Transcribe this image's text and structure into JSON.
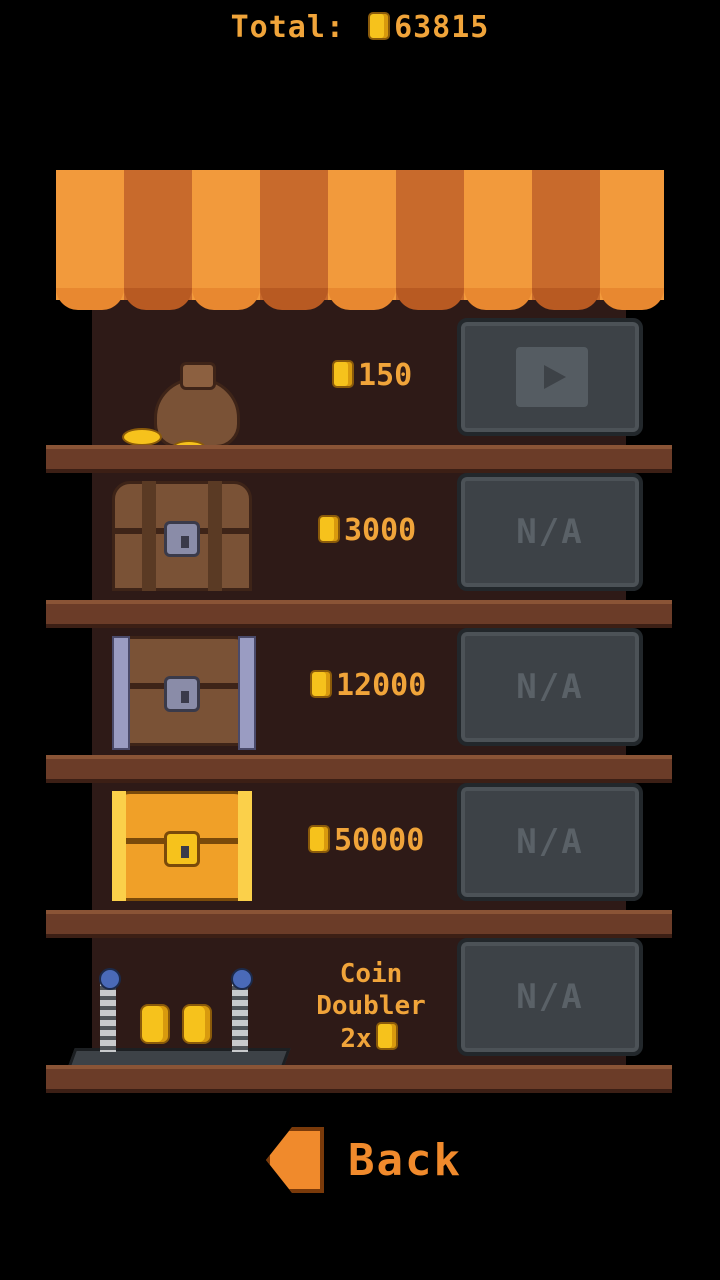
{
  "header": {
    "total_label": "Total:",
    "total_value": "63815"
  },
  "shop": {
    "items": [
      {
        "name": "coin-bag",
        "price": "150",
        "button_icon": "video-play-icon"
      },
      {
        "name": "wooden-chest",
        "price": "3000",
        "button_label": "N/A"
      },
      {
        "name": "iron-chest",
        "price": "12000",
        "button_label": "N/A"
      },
      {
        "name": "golden-chest",
        "price": "50000",
        "button_label": "N/A"
      },
      {
        "name": "coin-doubler",
        "label_line1": "Coin",
        "label_line2": "Doubler",
        "label_line3": "2x",
        "button_label": "N/A"
      }
    ]
  },
  "footer": {
    "back_label": "Back"
  },
  "colors": {
    "accent": "#f0a43a",
    "awning_light": "#f29a3c",
    "awning_dark": "#c86a2c",
    "shelf": "#6b3c28",
    "button": "#3d4247"
  }
}
